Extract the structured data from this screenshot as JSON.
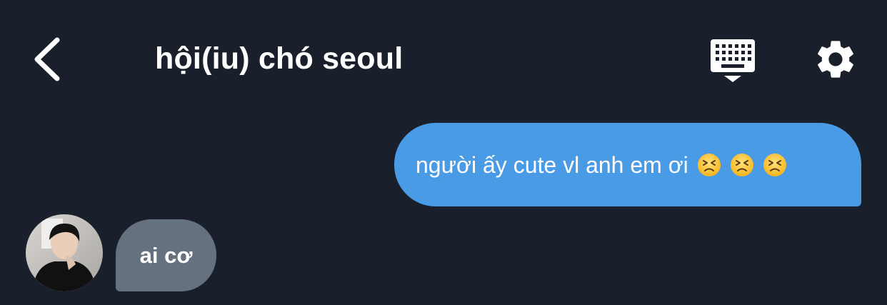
{
  "header": {
    "title": "hội(iu) chó seoul",
    "back_icon": "chevron-left-icon",
    "keyboard_icon": "keyboard-icon",
    "settings_icon": "gear-icon"
  },
  "messages": [
    {
      "direction": "outgoing",
      "text": "người ấy cute vl anh em ơi",
      "emoji": [
        "😣",
        "😣",
        "😣"
      ]
    },
    {
      "direction": "incoming",
      "text": "ai cơ"
    }
  ],
  "colors": {
    "background": "#19202b",
    "outgoing_bubble": "#4a9be6",
    "incoming_bubble": "#66717f",
    "text": "#ffffff"
  }
}
